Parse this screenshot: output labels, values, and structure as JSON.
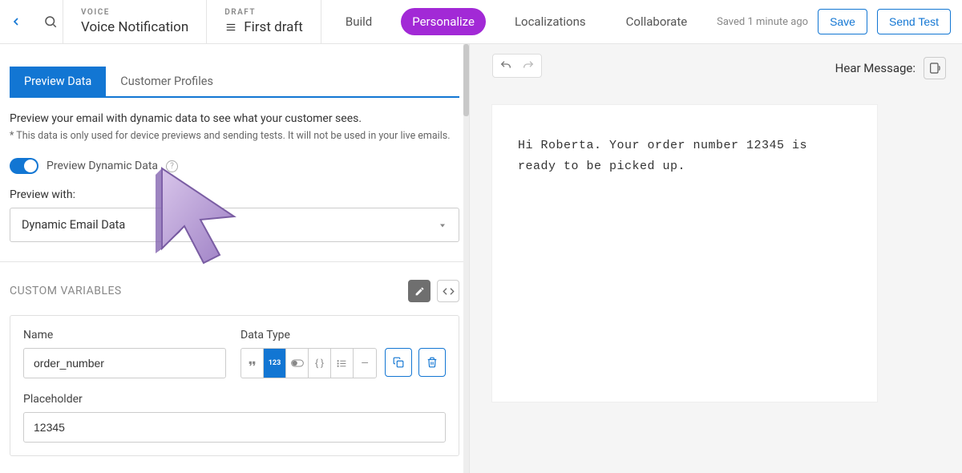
{
  "header": {
    "voice_label": "VOICE",
    "voice_title": "Voice Notification",
    "draft_label": "DRAFT",
    "draft_title": "First draft",
    "nav": {
      "build": "Build",
      "personalize": "Personalize",
      "localizations": "Localizations",
      "collaborate": "Collaborate"
    },
    "saved_ago": "Saved 1 minute ago",
    "save_btn": "Save",
    "send_test_btn": "Send Test"
  },
  "preview_bar": {
    "hear_label": "Hear Message:"
  },
  "tabs": {
    "preview_data": "Preview Data",
    "customer_profiles": "Customer Profiles"
  },
  "preview": {
    "desc": "Preview your email with dynamic data to see what your customer sees.",
    "note": "* This data is only used for device previews and sending tests. It will not be used in your live emails.",
    "toggle_label": "Preview Dynamic Data",
    "preview_with_label": "Preview with:",
    "dropdown_value": "Dynamic Email Data"
  },
  "custom_vars": {
    "title": "CUSTOM VARIABLES",
    "name_label": "Name",
    "name_value": "order_number",
    "datatype_label": "Data Type",
    "placeholder_label": "Placeholder",
    "placeholder_value": "12345"
  },
  "message": {
    "text": "Hi Roberta. Your order number 12345 is ready to be picked up."
  }
}
